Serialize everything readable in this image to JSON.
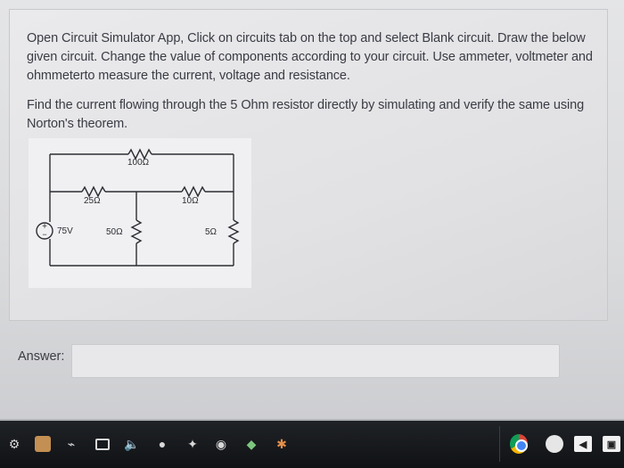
{
  "question": {
    "paragraph1": "Open Circuit Simulator App, Click on circuits tab on the top and select Blank circuit. Draw the below given circuit. Change the value of components according to your circuit. Use ammeter, voltmeter and ohmmeterto measure the current, voltage and resistance.",
    "paragraph2": "Find the current flowing through the 5 Ohm resistor directly by simulating and verify the same using Norton's theorem."
  },
  "circuit": {
    "r_top": "100Ω",
    "r_left": "25Ω",
    "r_right": "10Ω",
    "source": "75V",
    "r_mid_vertical": "50Ω",
    "r_right_vertical": "5Ω"
  },
  "answer": {
    "label": "Answer:",
    "value": ""
  },
  "taskbar": {
    "icons": [
      "settings-gear-icon",
      "files-icon",
      "wifi-icon",
      "battery-icon",
      "volume-icon",
      "cloud-icon",
      "photos-icon",
      "camera-icon",
      "security-icon",
      "app-icon",
      "chrome-icon",
      "profile-icon",
      "video-icon",
      "store-icon"
    ]
  }
}
